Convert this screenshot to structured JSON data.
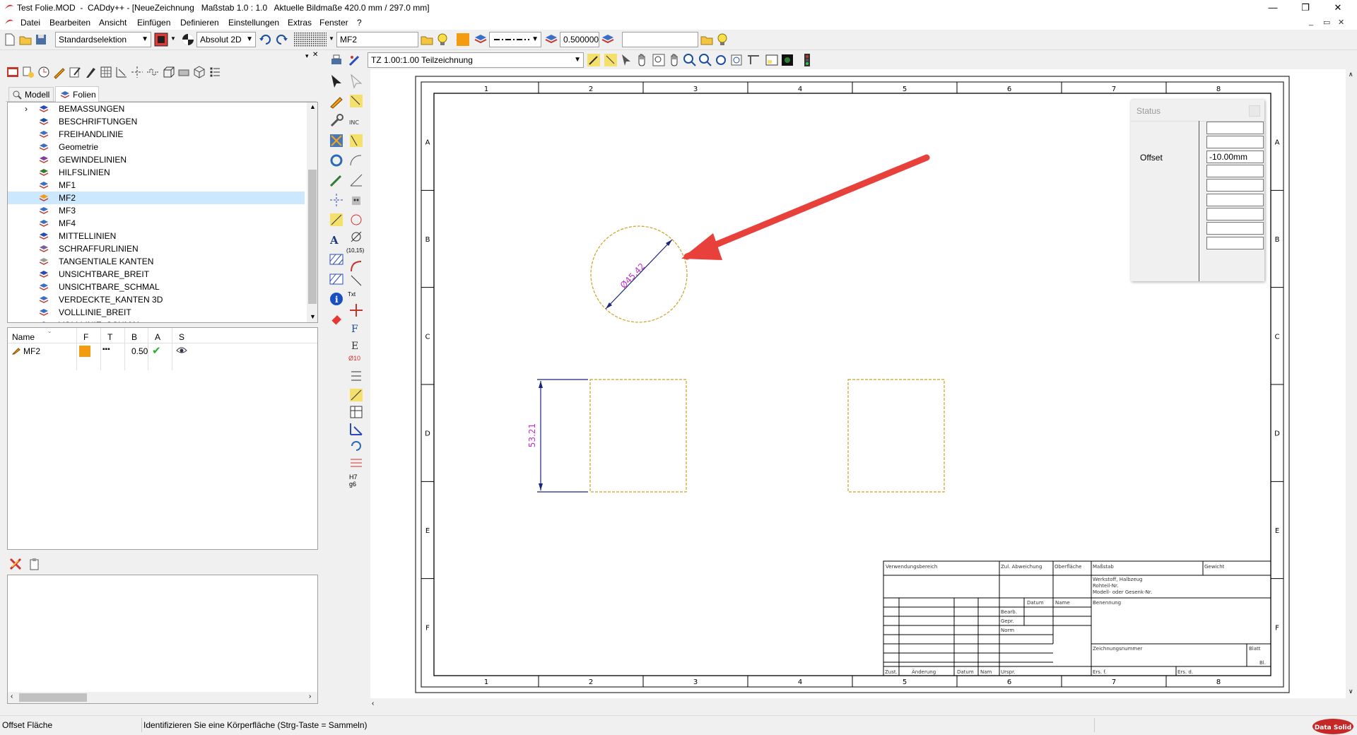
{
  "window": {
    "title": "Test Folie.MOD  -  CADdy++ - [NeueZeichnung   Maßstab 1.0 : 1.0   Aktuelle Bildmaße 420.0 mm / 297.0 mm]",
    "minimize": "—",
    "restore": "❐",
    "close": "✕"
  },
  "menu": {
    "items": [
      "Datei",
      "Bearbeiten",
      "Ansicht",
      "Einfügen",
      "Definieren",
      "Einstellungen",
      "Extras",
      "Fenster",
      "?"
    ],
    "mdi_min": "_",
    "mdi_restore": "▭",
    "mdi_close": "✕"
  },
  "toolbar": {
    "selection_mode": "Standardselektion",
    "coord_mode": "Absolut 2D",
    "layer": "MF2",
    "line_width": "0.500000",
    "search_value": ""
  },
  "toolbar2": {
    "view_combo": "TZ 1.00:1.00 Teilzeichnung"
  },
  "left_panel": {
    "tabs": [
      "Modell",
      "Folien"
    ],
    "layers": [
      "BEMASSUNGEN",
      "BESCHRIFTUNGEN",
      "FREIHANDLINIE",
      "Geometrie",
      "GEWINDELINIEN",
      "HILFSLINIEN",
      "MF1",
      "MF2",
      "MF3",
      "MF4",
      "MITTELLINIEN",
      "SCHRAFFURLINIEN",
      "TANGENTIALE KANTEN",
      "UNSICHTBARE_BREIT",
      "UNSICHTBARE_SCHMAL",
      "VERDECKTE_KANTEN 3D",
      "VOLLLINIE_BREIT",
      "VOLLLINIE_SCHMAL"
    ],
    "selected_layer": "MF2",
    "prop_columns": [
      "Name",
      "F",
      "T",
      "B",
      "A",
      "S"
    ],
    "prop_row": {
      "name": "MF2",
      "color": "#f39c12",
      "linetype": "▪▪▪",
      "width": "0.50",
      "active": "✔",
      "visible": "👁"
    }
  },
  "drawing": {
    "col_numbers": [
      "1",
      "2",
      "3",
      "4",
      "5",
      "6",
      "7",
      "8"
    ],
    "row_letters": [
      "A",
      "B",
      "C",
      "D",
      "E",
      "F"
    ],
    "circle_dim": "Ø45.42",
    "rect_dim": "53.21",
    "title_block": {
      "verwendungsbereich": "Verwendungsbereich",
      "zul_abweichung": "Zul. Abweichung",
      "oberflaeche": "Oberfläche",
      "massstab": "Maßstab",
      "gewicht": "Gewicht",
      "werkstoff": "Werkstoff, Halbzeug",
      "rohteil": "Rohteil-Nr.",
      "modell": "Modell- oder Gesenk-Nr.",
      "datum": "Datum",
      "name": "Name",
      "bearb": "Bearb.",
      "gepr": "Gepr.",
      "norm": "Norm",
      "benennung": "Benennung",
      "zeichnungsnummer": "Zeichnungsnummer",
      "blatt": "Blatt",
      "bl": "Bl.",
      "zust": "Zust.",
      "aenderung": "Änderung",
      "datum2": "Datum",
      "nam": "Nam",
      "urspr": "Urspr.",
      "ers_f": "Ers. f.",
      "ers_d": "Ers. d."
    }
  },
  "status_dialog": {
    "title": "Status",
    "label": "Offset",
    "value": "-10.00mm"
  },
  "statusbar": {
    "mode": "Offset Fläche",
    "hint": "Identifizieren Sie eine Körperfläche (Strg-Taste = Sammeln)",
    "logo": "Data Solid"
  },
  "colors": {
    "arrow": "#e8413c",
    "dashed": "#c9a227",
    "dim_text": "#c034c0",
    "dim_line": "#1a237e"
  }
}
